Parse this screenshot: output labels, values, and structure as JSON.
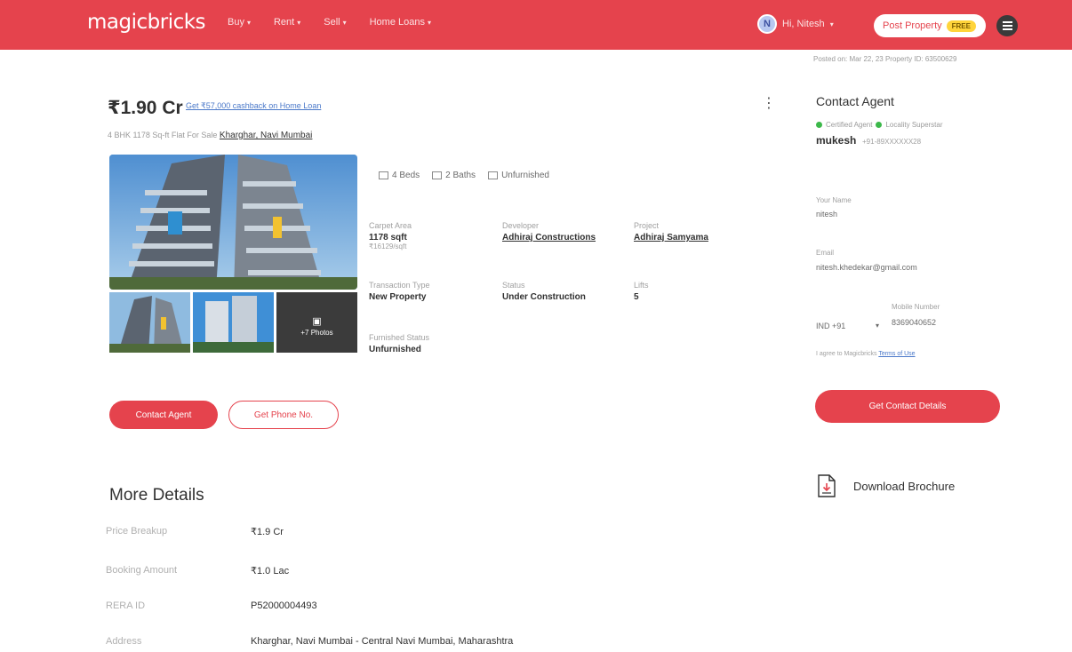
{
  "header": {
    "logo": "magicbricks",
    "nav": [
      "Buy",
      "Rent",
      "Sell",
      "Home Loans"
    ],
    "user_initial": "N",
    "user_name": "Hi, Nitesh",
    "post_property": "Post Property",
    "free_badge": "FREE"
  },
  "posted": "Posted on: Mar 22, 23    Property ID: 63500629",
  "listing": {
    "price": "₹1.90 Cr",
    "cashback": "Get ₹57,000 cashback on Home Loan",
    "subtitle_prefix": "4 BHK 1178 Sq-ft Flat For Sale",
    "subtitle_link": "Kharghar, Navi Mumbai",
    "more_photos": "+7 Photos",
    "amenities": [
      "4 Beds",
      "2 Baths",
      "Unfurnished"
    ],
    "specs": {
      "carpet_label": "Carpet Area",
      "carpet_value": "1178 sqft",
      "carpet_sub": "₹16129/sqft",
      "developer_label": "Developer",
      "developer_value": "Adhiraj Constructions",
      "project_label": "Project",
      "project_value": "Adhiraj Samyama",
      "transaction_label": "Transaction Type",
      "transaction_value": "New Property",
      "status_label": "Status",
      "status_value": "Under Construction",
      "lifts_label": "Lifts",
      "lifts_value": "5",
      "furnished_label": "Furnished Status",
      "furnished_value": "Unfurnished"
    },
    "contact_agent": "Contact Agent",
    "get_phone": "Get Phone No."
  },
  "more_details": {
    "title": "More Details",
    "rows": [
      {
        "label": "Price Breakup",
        "value": "₹1.9 Cr"
      },
      {
        "label": "Booking Amount",
        "value": "₹1.0 Lac"
      },
      {
        "label": "RERA ID",
        "value": "P52000004493"
      },
      {
        "label": "Address",
        "value": "Kharghar, Navi Mumbai - Central Navi Mumbai, Maharashtra"
      }
    ]
  },
  "agent": {
    "title": "Contact Agent",
    "tag1": "Certified Agent",
    "tag2": "Locality Superstar",
    "name": "mukesh",
    "phone": "+91-89XXXXXX28",
    "name_label": "Your Name",
    "name_value": "nitesh",
    "email_label": "Email",
    "email_value": "nitesh.khedekar@gmail.com",
    "isd": "IND +91",
    "mobile_label": "Mobile Number",
    "mobile_value": "8369040652",
    "terms_prefix": "I agree to Magicbricks",
    "terms_link": "Terms of Use",
    "get_details": "Get Contact Details",
    "brochure": "Download Brochure"
  },
  "colors": {
    "brand": "#e5434d",
    "link": "#4a78c9",
    "badge": "#ffd43b",
    "verified": "#3cb84a"
  }
}
